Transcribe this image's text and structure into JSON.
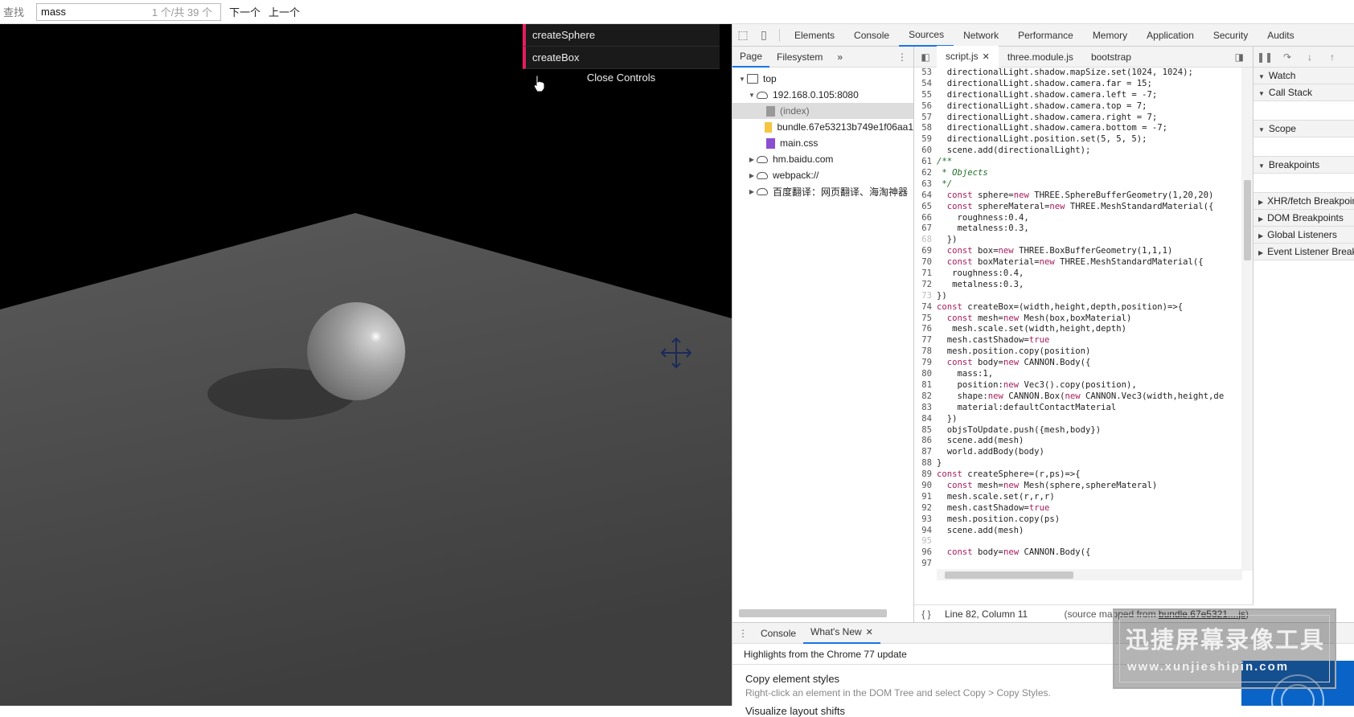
{
  "findbar": {
    "label": "查找",
    "query": "mass",
    "count": "1 个/共 39 个",
    "next": "下一个",
    "prev": "上一个"
  },
  "gui": {
    "items": [
      "createSphere",
      "createBox"
    ],
    "close": "Close Controls"
  },
  "devtools": {
    "tabs": [
      "Elements",
      "Console",
      "Sources",
      "Network",
      "Performance",
      "Memory",
      "Application",
      "Security",
      "Audits"
    ],
    "active_tab": "Sources",
    "navigator": {
      "tabs": [
        "Page",
        "Filesystem"
      ],
      "more": "»",
      "tree": [
        {
          "label": "top",
          "indent": 0,
          "arrow": "▼",
          "icon": "frame"
        },
        {
          "label": "192.168.0.105:8080",
          "indent": 1,
          "arrow": "▼",
          "icon": "cloud"
        },
        {
          "label": "(index)",
          "indent": 2,
          "arrow": "",
          "icon": "file-gray",
          "selected": true
        },
        {
          "label": "bundle.67e53213b749e1f06aa1",
          "indent": 2,
          "arrow": "",
          "icon": "file-yellow"
        },
        {
          "label": "main.css",
          "indent": 2,
          "arrow": "",
          "icon": "file-purple"
        },
        {
          "label": "hm.baidu.com",
          "indent": 1,
          "arrow": "▶",
          "icon": "cloud"
        },
        {
          "label": "webpack://",
          "indent": 1,
          "arrow": "▶",
          "icon": "cloud"
        },
        {
          "label": "百度翻译：网页翻译、海淘神器",
          "indent": 1,
          "arrow": "▶",
          "icon": "cloud"
        }
      ]
    },
    "editor": {
      "tabs": [
        "script.js",
        "three.module.js",
        "bootstrap"
      ],
      "status_position": "Line 82, Column 11",
      "status_map_prefix": "(source mapped from ",
      "status_map_link": "bundle.67e5321....js",
      "status_map_suffix": ")",
      "lines": [
        {
          "n": 53,
          "html": "  directionalLight.shadow.mapSize.set(1024, 1024);"
        },
        {
          "n": 54,
          "html": "  directionalLight.shadow.camera.far = 15;"
        },
        {
          "n": 55,
          "html": "  directionalLight.shadow.camera.left = -7;"
        },
        {
          "n": 56,
          "html": "  directionalLight.shadow.camera.top = 7;"
        },
        {
          "n": 57,
          "html": "  directionalLight.shadow.camera.right = 7;"
        },
        {
          "n": 58,
          "html": "  directionalLight.shadow.camera.bottom = -7;"
        },
        {
          "n": 59,
          "html": "  directionalLight.position.set(5, 5, 5);"
        },
        {
          "n": 60,
          "html": "  scene.add(directionalLight);"
        },
        {
          "n": 61,
          "html": "<span class='cm'>/**</span>"
        },
        {
          "n": 62,
          "html": "<span class='cm'> * Objects</span>"
        },
        {
          "n": 63,
          "html": "<span class='cm'> */</span>"
        },
        {
          "n": 64,
          "html": "  <span class='kw'>const</span> sphere=<span class='kw'>new</span> THREE.SphereBufferGeometry(1,20,20)"
        },
        {
          "n": 65,
          "html": "  <span class='kw'>const</span> sphereMateral=<span class='kw'>new</span> THREE.MeshStandardMaterial({"
        },
        {
          "n": 66,
          "html": "    roughness:0.4,"
        },
        {
          "n": 67,
          "html": "    metalness:0.3,"
        },
        {
          "n": 68,
          "html": "  })",
          "dim": true
        },
        {
          "n": 69,
          "html": "  <span class='kw'>const</span> box=<span class='kw'>new</span> THREE.BoxBufferGeometry(1,1,1)"
        },
        {
          "n": 70,
          "html": "  <span class='kw'>const</span> boxMaterial=<span class='kw'>new</span> THREE.MeshStandardMaterial({"
        },
        {
          "n": 71,
          "html": "   roughness:0.4,"
        },
        {
          "n": 72,
          "html": "   metalness:0.3,"
        },
        {
          "n": 73,
          "html": "})",
          "dim": true
        },
        {
          "n": 74,
          "html": "<span class='kw'>const</span> createBox=(width,height,depth,position)=>{"
        },
        {
          "n": 75,
          "html": "  <span class='kw'>const</span> mesh=<span class='kw'>new</span> Mesh(box,boxMaterial)"
        },
        {
          "n": 76,
          "html": "   mesh.scale.set(width,height,depth)"
        },
        {
          "n": 77,
          "html": "  mesh.castShadow=<span class='kw'>true</span>"
        },
        {
          "n": 78,
          "html": "  mesh.position.copy(position)"
        },
        {
          "n": 79,
          "html": "  <span class='kw'>const</span> body=<span class='kw'>new</span> CANNON.Body({"
        },
        {
          "n": 80,
          "html": "    mass:1,"
        },
        {
          "n": 81,
          "html": "    position:<span class='kw'>new</span> Vec3().copy(position),"
        },
        {
          "n": 82,
          "html": "    shape:<span class='kw'>new</span> CANNON.Box(<span class='kw'>new</span> CANNON.Vec3(width,height,de"
        },
        {
          "n": 83,
          "html": "    material:defaultContactMaterial"
        },
        {
          "n": 84,
          "html": "  })"
        },
        {
          "n": 85,
          "html": "  objsToUpdate.push({mesh,body})"
        },
        {
          "n": 86,
          "html": "  scene.add(mesh)"
        },
        {
          "n": 87,
          "html": "  world.addBody(body)"
        },
        {
          "n": 88,
          "html": "}"
        },
        {
          "n": 89,
          "html": "<span class='kw'>const</span> createSphere=(r,ps)=>{"
        },
        {
          "n": 90,
          "html": "  <span class='kw'>const</span> mesh=<span class='kw'>new</span> Mesh(sphere,sphereMateral)"
        },
        {
          "n": 91,
          "html": "  mesh.scale.set(r,r,r)"
        },
        {
          "n": 92,
          "html": "  mesh.castShadow=<span class='kw'>true</span>"
        },
        {
          "n": 93,
          "html": "  mesh.position.copy(ps)"
        },
        {
          "n": 94,
          "html": "  scene.add(mesh)"
        },
        {
          "n": 95,
          "html": "",
          "dim": true
        },
        {
          "n": 96,
          "html": "  <span class='kw'>const</span> body=<span class='kw'>new</span> CANNON.Body({"
        },
        {
          "n": 97,
          "html": "",
          "dim": false
        }
      ]
    },
    "debugger": {
      "sections": [
        "Watch",
        "Call Stack",
        "Scope",
        "Breakpoints",
        "XHR/fetch Breakpoints",
        "DOM Breakpoints",
        "Global Listeners",
        "Event Listener Breakpoints"
      ]
    },
    "drawer": {
      "tabs": [
        "Console",
        "What's New"
      ],
      "heading": "Highlights from the Chrome 77 update",
      "item1_title": "Copy element styles",
      "item1_desc": "Right-click an element in the DOM Tree and select Copy > Copy Styles.",
      "item2_title": "Visualize layout shifts"
    }
  },
  "watermark": {
    "title": "迅捷屏幕录像工具",
    "url": "www.xunjieshipin.com"
  },
  "colors": {
    "gui_accent": "#e61d5f",
    "active_tab_underline": "#1a73e8"
  }
}
